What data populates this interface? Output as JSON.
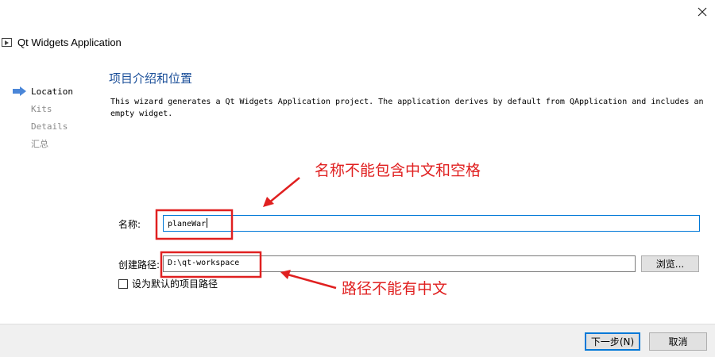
{
  "window": {
    "title": "Qt Widgets Application",
    "close_glyph": "✕"
  },
  "sidebar": {
    "items": [
      {
        "label": "Location",
        "active": true
      },
      {
        "label": "Kits",
        "active": false
      },
      {
        "label": "Details",
        "active": false
      },
      {
        "label": "汇总",
        "active": false
      }
    ]
  },
  "main": {
    "heading": "项目介绍和位置",
    "description": "This wizard generates a Qt Widgets Application project. The application derives by default from QApplication and includes an empty widget.",
    "name_label": "名称:",
    "name_value": "planeWar",
    "path_label": "创建路径:",
    "path_value": "D:\\qt-workspace",
    "browse_label": "浏览...",
    "default_path_label": "设为默认的项目路径",
    "default_path_checked": false
  },
  "annotations": {
    "name_note": "名称不能包含中文和空格",
    "path_note": "路径不能有中文",
    "color": "#e02020"
  },
  "footer": {
    "next_label": "下一步(N)",
    "cancel_label": "取消"
  },
  "icons": {
    "active_step": "arrow-right-icon",
    "window": "qt-app-icon",
    "close": "close-icon"
  }
}
